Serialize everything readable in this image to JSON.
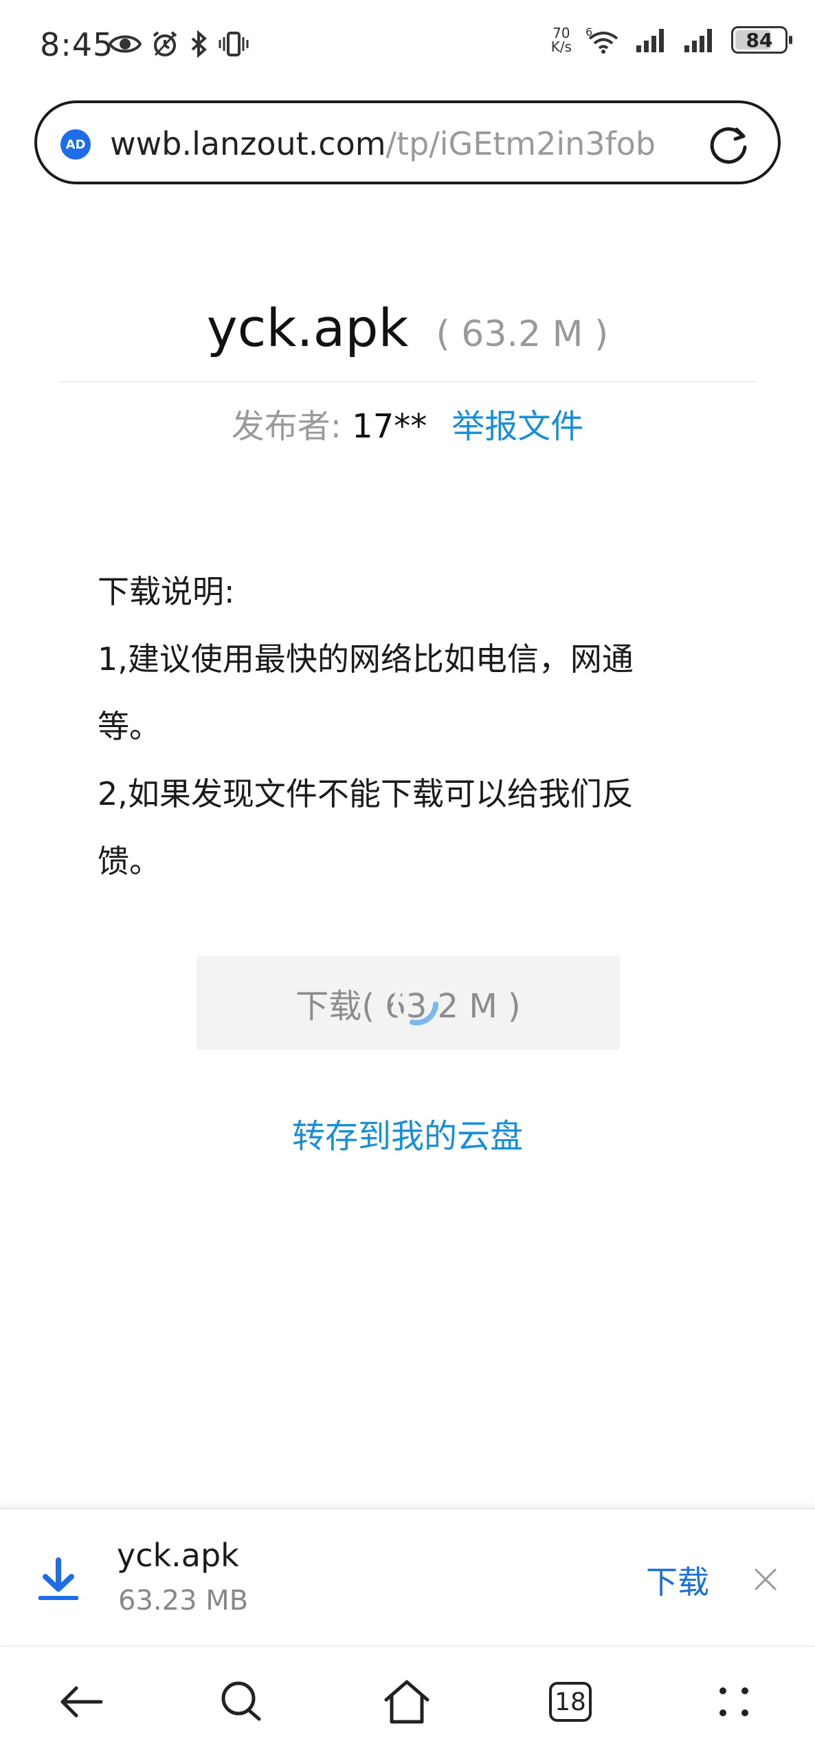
{
  "status_bar": {
    "time": "8:45",
    "net_speed_value": "70",
    "net_speed_unit": "K/s",
    "wifi_label": "6",
    "battery": "84"
  },
  "url_bar": {
    "host": "wwb.lanzout.com",
    "path": "/tp/iGEtm2in3fob",
    "ad_badge": "AD"
  },
  "file": {
    "name": "yck.apk",
    "size": "( 63.2 M )",
    "publisher_label": "发布者: ",
    "publisher_name": "17**",
    "report_link": "举报文件"
  },
  "description": {
    "lines": [
      "下载说明:",
      "1,建议使用最快的网络比如电信，网通",
      "等。",
      "2,如果发现文件不能下载可以给我们反",
      "馈。"
    ]
  },
  "download_button": {
    "label": "下载( 63.2 M )"
  },
  "save_cloud_link": "转存到我的云盘",
  "download_bar": {
    "file_name": "yck.apk",
    "file_size": "63.23 MB",
    "action_label": "下载"
  },
  "nav": {
    "tabs_count": "18"
  },
  "colors": {
    "link_blue": "#1a8fd8",
    "action_blue": "#1a6fd8",
    "download_icon_blue": "#1e6de8"
  }
}
